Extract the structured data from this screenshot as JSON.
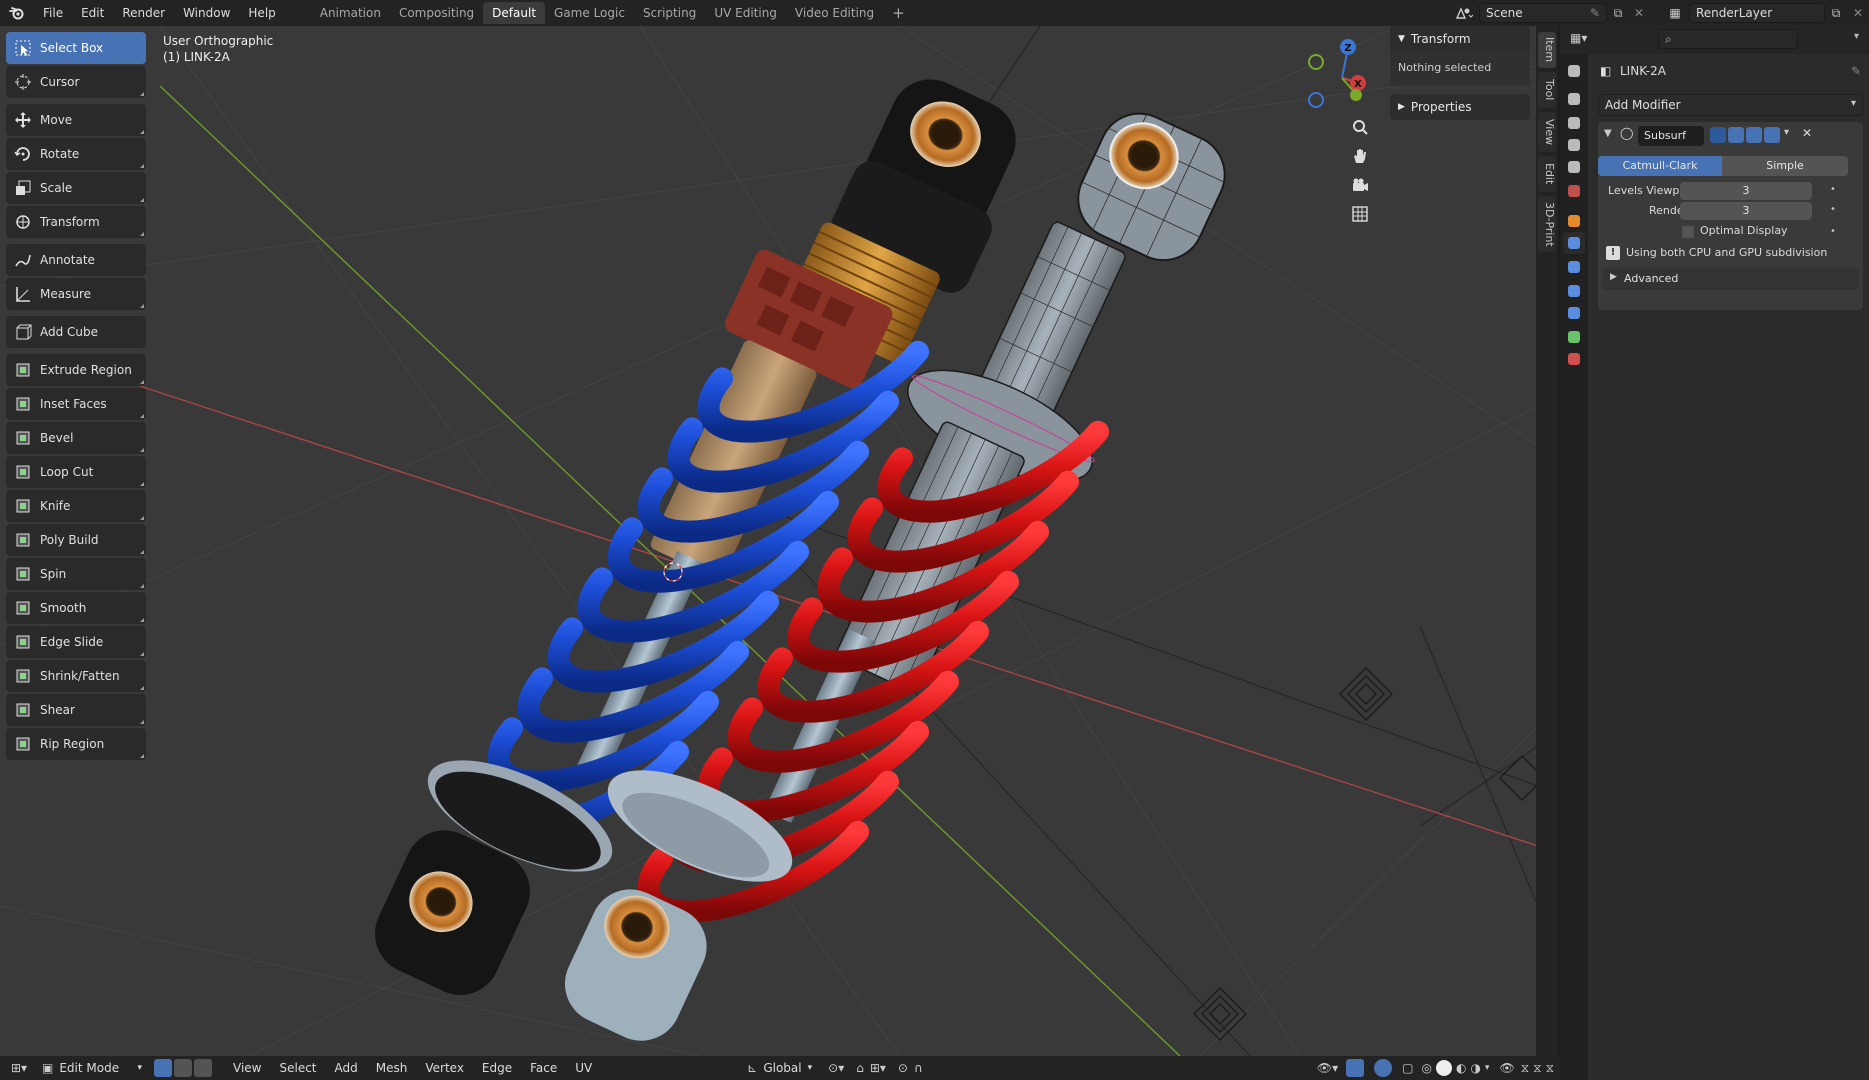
{
  "topbar": {
    "menus": [
      "File",
      "Edit",
      "Render",
      "Window",
      "Help"
    ],
    "workspaces": [
      "Animation",
      "Compositing",
      "Default",
      "Game Logic",
      "Scripting",
      "UV Editing",
      "Video Editing"
    ],
    "active_workspace": "Default",
    "add_workspace": "+",
    "scene_name": "Scene",
    "view_layer": "RenderLayer"
  },
  "viewport": {
    "view_name": "User Orthographic",
    "object_label": "(1) LINK-2A"
  },
  "toolbar": {
    "tools": [
      {
        "label": "Select Box",
        "icon": "select-box-icon",
        "active": true
      },
      {
        "label": "Cursor",
        "icon": "cursor-icon"
      },
      {
        "label": "Move",
        "icon": "move-icon"
      },
      {
        "label": "Rotate",
        "icon": "rotate-icon"
      },
      {
        "label": "Scale",
        "icon": "scale-icon"
      },
      {
        "label": "Transform",
        "icon": "transform-icon"
      },
      {
        "label": "Annotate",
        "icon": "annotate-icon"
      },
      {
        "label": "Measure",
        "icon": "measure-icon"
      },
      {
        "label": "Add Cube",
        "icon": "add-cube-icon"
      },
      {
        "label": "Extrude Region",
        "icon": "extrude-region-icon"
      },
      {
        "label": "Inset Faces",
        "icon": "inset-faces-icon"
      },
      {
        "label": "Bevel",
        "icon": "bevel-icon"
      },
      {
        "label": "Loop Cut",
        "icon": "loop-cut-icon"
      },
      {
        "label": "Knife",
        "icon": "knife-icon"
      },
      {
        "label": "Poly Build",
        "icon": "poly-build-icon"
      },
      {
        "label": "Spin",
        "icon": "spin-icon"
      },
      {
        "label": "Smooth",
        "icon": "smooth-icon"
      },
      {
        "label": "Edge Slide",
        "icon": "edge-slide-icon"
      },
      {
        "label": "Shrink/Fatten",
        "icon": "shrink-fatten-icon"
      },
      {
        "label": "Shear",
        "icon": "shear-icon"
      },
      {
        "label": "Rip Region",
        "icon": "rip-region-icon"
      }
    ]
  },
  "npanel": {
    "transform_header": "Transform",
    "nothing_selected": "Nothing selected",
    "properties_header": "Properties",
    "tabs": [
      "Item",
      "Tool",
      "View",
      "Edit",
      "3D-Print"
    ]
  },
  "properties": {
    "object_name": "LINK-2A",
    "add_modifier": "Add Modifier",
    "modifier_name": "Subsurf",
    "mode_catmull": "Catmull-Clark",
    "mode_simple": "Simple",
    "levels_viewport_label": "Levels Viewport",
    "levels_viewport_value": "3",
    "render_label": "Render",
    "render_value": "3",
    "optimal_display_label": "Optimal Display",
    "info_text": "Using both CPU and GPU subdivision",
    "advanced_label": "Advanced"
  },
  "bottombar": {
    "mode": "Edit Mode",
    "menus": [
      "View",
      "Select",
      "Add",
      "Mesh",
      "Vertex",
      "Edge",
      "Face",
      "UV"
    ],
    "orientation": "Global"
  },
  "colors": {
    "accent": "#4772b3",
    "spring_blue": "#1e4fd6",
    "spring_red": "#d81414",
    "x_axis": "#c44a4a",
    "y_axis": "#7aa829",
    "z_axis": "#3b75d6"
  }
}
